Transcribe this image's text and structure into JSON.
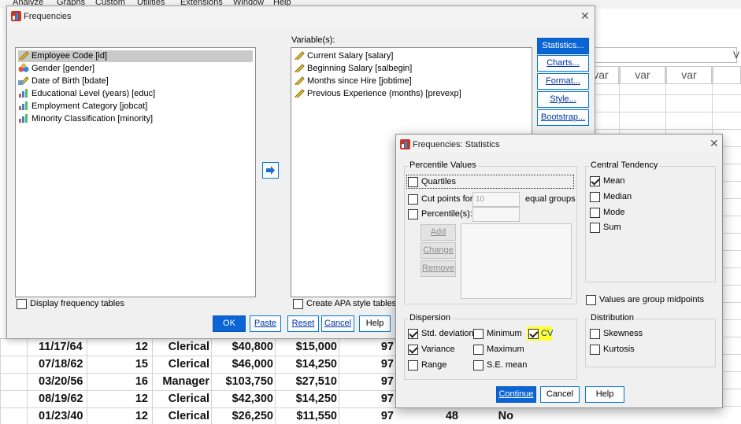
{
  "menubar": {
    "items": [
      "Analyze",
      "Graphs",
      "Custom",
      "Utilities",
      "Extensions",
      "Window",
      "Help"
    ]
  },
  "data_editor": {
    "var_header": "var",
    "extra_char": "V",
    "rows": [
      [
        "11/17/64",
        "12",
        "Clerical",
        "$40,800",
        "$15,000",
        "97"
      ],
      [
        "07/18/62",
        "15",
        "Clerical",
        "$46,000",
        "$14,250",
        "97"
      ],
      [
        "03/20/56",
        "16",
        "Manager",
        "$103,750",
        "$27,510",
        "97"
      ],
      [
        "08/19/62",
        "12",
        "Clerical",
        "$42,300",
        "$14,250",
        "97"
      ],
      [
        "01/23/40",
        "12",
        "Clerical",
        "$26,250",
        "$11,550",
        "97"
      ]
    ],
    "partial_row_extra": [
      "48",
      "No"
    ]
  },
  "freq_dialog": {
    "title": "Frequencies",
    "source_vars": [
      {
        "label": "Employee Code [id]",
        "icon": "scale-ruler-icon",
        "selected": true
      },
      {
        "label": "Gender [gender]",
        "icon": "nominal-icon"
      },
      {
        "label": "Date of Birth [bdate]",
        "icon": "date-scale-icon"
      },
      {
        "label": "Educational Level (years) [educ]",
        "icon": "ordinal-bars-icon"
      },
      {
        "label": "Employment Category [jobcat]",
        "icon": "ordinal-bars-icon"
      },
      {
        "label": "Minority Classification [minority]",
        "icon": "ordinal-bars-icon"
      }
    ],
    "variables_label": "Variable(s):",
    "target_vars": [
      {
        "label": "Current Salary [salary]"
      },
      {
        "label": "Beginning Salary [salbegin]"
      },
      {
        "label": "Months since Hire [jobtime]"
      },
      {
        "label": "Previous Experience (months) [prevexp]"
      }
    ],
    "side_buttons": [
      "Statistics...",
      "Charts...",
      "Format...",
      "Style...",
      "Bootstrap..."
    ],
    "display_freq_label": "Display frequency tables",
    "apa_label": "Create APA style tables",
    "bottom_buttons": [
      "OK",
      "Paste",
      "Reset",
      "Cancel",
      "Help"
    ]
  },
  "stats_dialog": {
    "title": "Frequencies: Statistics",
    "percentile_group": "Percentile Values",
    "quartiles": "Quartiles",
    "cut_points": "Cut points for:",
    "cut_points_value": "10",
    "equal_groups": "equal groups",
    "percentiles": "Percentile(s):",
    "add": "Add",
    "change": "Change",
    "remove": "Remove",
    "central_group": "Central Tendency",
    "mean": "Mean",
    "median": "Median",
    "mode": "Mode",
    "sum": "Sum",
    "group_midpoints": "Values are group midpoints",
    "dispersion_group": "Dispersion",
    "std_dev": "Std. deviation",
    "minimum": "Minimum",
    "cv": "CV",
    "variance": "Variance",
    "maximum": "Maximum",
    "range": "Range",
    "se_mean": "S.E. mean",
    "distribution_group": "Distribution",
    "skewness": "Skewness",
    "kurtosis": "Kurtosis",
    "continue": "Continue",
    "cancel": "Cancel",
    "help": "Help",
    "highlight_color": "#ffff33"
  }
}
